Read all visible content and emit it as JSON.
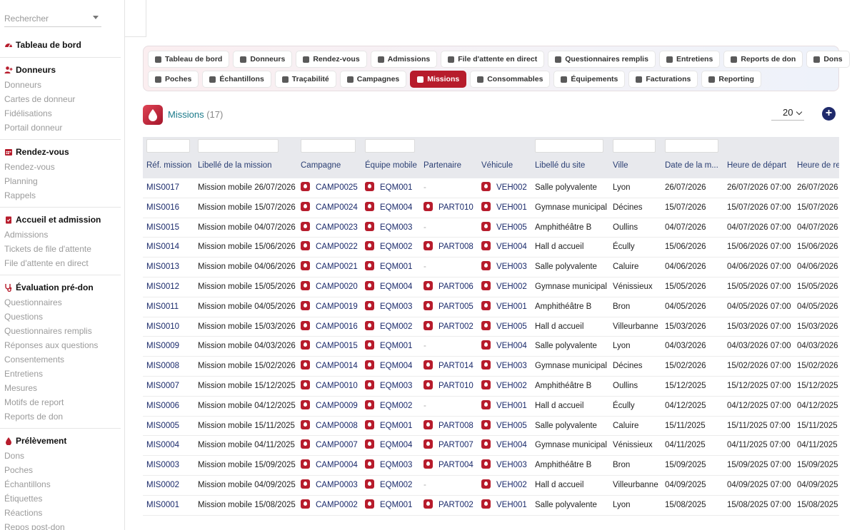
{
  "search": {
    "placeholder": "Rechercher"
  },
  "sidebar": {
    "dashboard": "Tableau de bord",
    "sections": [
      {
        "title": "Donneurs",
        "icon": "user-plus-icon",
        "items": [
          "Donneurs",
          "Cartes de donneur",
          "Fidélisations",
          "Portail donneur"
        ]
      },
      {
        "title": "Rendez-vous",
        "icon": "calendar-icon",
        "items": [
          "Rendez-vous",
          "Planning",
          "Rappels"
        ]
      },
      {
        "title": "Accueil et admission",
        "icon": "clipboard-icon",
        "items": [
          "Admissions",
          "Tickets de file d'attente",
          "File d'attente en direct"
        ]
      },
      {
        "title": "Évaluation pré-don",
        "icon": "stethoscope-icon",
        "items": [
          "Questionnaires",
          "Questions",
          "Questionnaires remplis",
          "Réponses aux questions",
          "Consentements",
          "Entretiens",
          "Mesures",
          "Motifs de report",
          "Reports de don"
        ]
      },
      {
        "title": "Prélèvement",
        "icon": "drop-icon",
        "items": [
          "Dons",
          "Poches",
          "Échantillons",
          "Étiquettes",
          "Réactions",
          "Repos post-don"
        ]
      }
    ]
  },
  "tabs": {
    "row1": [
      "Tableau de bord",
      "Donneurs",
      "Rendez-vous",
      "Admissions",
      "File d'attente en direct",
      "Questionnaires remplis",
      "Entretiens",
      "Reports de don",
      "Dons"
    ],
    "row2": [
      "Poches",
      "Échantillons",
      "Traçabilité",
      "Campagnes",
      "Missions",
      "Consommables",
      "Équipements",
      "Facturations",
      "Reporting"
    ],
    "active": "Missions"
  },
  "header": {
    "title": "Missions",
    "count": "(17)",
    "page_size": "20",
    "add_label": "+"
  },
  "table": {
    "columns": [
      "Réf. mission",
      "Libellé de la mission",
      "Campagne",
      "Équipe mobile",
      "Partenaire",
      "Véhicule",
      "Libellé du site",
      "Ville",
      "Date de la m...",
      "Heure de départ",
      "Heure de re"
    ],
    "rows": [
      [
        "MIS0017",
        "Mission mobile 26/07/2026",
        "CAMP0025",
        "EQM001",
        "-",
        "VEH002",
        "Salle polyvalente",
        "Lyon",
        "26/07/2026",
        "26/07/2026 07:00",
        "26/07/2026"
      ],
      [
        "MIS0016",
        "Mission mobile 15/07/2026",
        "CAMP0024",
        "EQM004",
        "PART010",
        "VEH001",
        "Gymnase municipal",
        "Décines",
        "15/07/2026",
        "15/07/2026 07:00",
        "15/07/2026"
      ],
      [
        "MIS0015",
        "Mission mobile 04/07/2026",
        "CAMP0023",
        "EQM003",
        "-",
        "VEH005",
        "Amphithéâtre B",
        "Oullins",
        "04/07/2026",
        "04/07/2026 07:00",
        "04/07/2026"
      ],
      [
        "MIS0014",
        "Mission mobile 15/06/2026",
        "CAMP0022",
        "EQM002",
        "PART008",
        "VEH004",
        "Hall d accueil",
        "Écully",
        "15/06/2026",
        "15/06/2026 07:00",
        "15/06/2026"
      ],
      [
        "MIS0013",
        "Mission mobile 04/06/2026",
        "CAMP0021",
        "EQM001",
        "-",
        "VEH003",
        "Salle polyvalente",
        "Caluire",
        "04/06/2026",
        "04/06/2026 07:00",
        "04/06/2026"
      ],
      [
        "MIS0012",
        "Mission mobile 15/05/2026",
        "CAMP0020",
        "EQM004",
        "PART006",
        "VEH002",
        "Gymnase municipal",
        "Vénissieux",
        "15/05/2026",
        "15/05/2026 07:00",
        "15/05/2026"
      ],
      [
        "MIS0011",
        "Mission mobile 04/05/2026",
        "CAMP0019",
        "EQM003",
        "PART005",
        "VEH001",
        "Amphithéâtre B",
        "Bron",
        "04/05/2026",
        "04/05/2026 07:00",
        "04/05/2026"
      ],
      [
        "MIS0010",
        "Mission mobile 15/03/2026",
        "CAMP0016",
        "EQM002",
        "PART002",
        "VEH005",
        "Hall d accueil",
        "Villeurbanne",
        "15/03/2026",
        "15/03/2026 07:00",
        "15/03/2026"
      ],
      [
        "MIS0009",
        "Mission mobile 04/03/2026",
        "CAMP0015",
        "EQM001",
        "-",
        "VEH004",
        "Salle polyvalente",
        "Lyon",
        "04/03/2026",
        "04/03/2026 07:00",
        "04/03/2026"
      ],
      [
        "MIS0008",
        "Mission mobile 15/02/2026",
        "CAMP0014",
        "EQM004",
        "PART014",
        "VEH003",
        "Gymnase municipal",
        "Décines",
        "15/02/2026",
        "15/02/2026 07:00",
        "15/02/2026"
      ],
      [
        "MIS0007",
        "Mission mobile 15/12/2025",
        "CAMP0010",
        "EQM003",
        "PART010",
        "VEH002",
        "Amphithéâtre B",
        "Oullins",
        "15/12/2025",
        "15/12/2025 07:00",
        "15/12/2025"
      ],
      [
        "MIS0006",
        "Mission mobile 04/12/2025",
        "CAMP0009",
        "EQM002",
        "-",
        "VEH001",
        "Hall d accueil",
        "Écully",
        "04/12/2025",
        "04/12/2025 07:00",
        "04/12/2025"
      ],
      [
        "MIS0005",
        "Mission mobile 15/11/2025",
        "CAMP0008",
        "EQM001",
        "PART008",
        "VEH005",
        "Salle polyvalente",
        "Caluire",
        "15/11/2025",
        "15/11/2025 07:00",
        "15/11/2025"
      ],
      [
        "MIS0004",
        "Mission mobile 04/11/2025",
        "CAMP0007",
        "EQM004",
        "PART007",
        "VEH004",
        "Gymnase municipal",
        "Vénissieux",
        "04/11/2025",
        "04/11/2025 07:00",
        "04/11/2025"
      ],
      [
        "MIS0003",
        "Mission mobile 15/09/2025",
        "CAMP0004",
        "EQM003",
        "PART004",
        "VEH003",
        "Amphithéâtre B",
        "Bron",
        "15/09/2025",
        "15/09/2025 07:00",
        "15/09/2025"
      ],
      [
        "MIS0002",
        "Mission mobile 04/09/2025",
        "CAMP0003",
        "EQM002",
        "-",
        "VEH002",
        "Hall d accueil",
        "Villeurbanne",
        "04/09/2025",
        "04/09/2025 07:00",
        "04/09/2025"
      ],
      [
        "MIS0001",
        "Mission mobile 15/08/2025",
        "CAMP0002",
        "EQM001",
        "PART002",
        "VEH001",
        "Salle polyvalente",
        "Lyon",
        "15/08/2025",
        "15/08/2025 07:00",
        "15/08/2025"
      ]
    ]
  },
  "colors": {
    "accent": "#b71c2c",
    "link": "#1a2a6b",
    "title": "#1a7a8a"
  }
}
